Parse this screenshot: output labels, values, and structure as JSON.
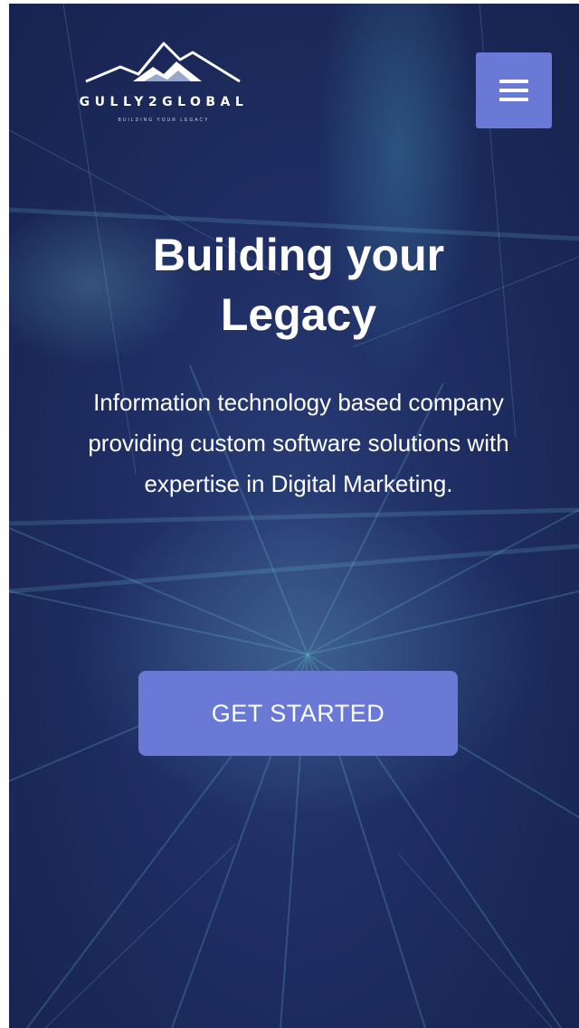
{
  "header": {
    "logo": {
      "name": "GULLY2GLOBAL",
      "tagline": "BUILDING YOUR LEGACY"
    },
    "menu_button": {
      "icon": "hamburger-menu-icon"
    }
  },
  "hero": {
    "title": "Building your Legacy",
    "description": "Information technology based company providing custom software solutions with expertise in Digital Marketing.",
    "cta_label": "GET STARTED"
  },
  "colors": {
    "background": "#1e2d62",
    "accent": "#6a78d6",
    "text": "#ffffff"
  }
}
